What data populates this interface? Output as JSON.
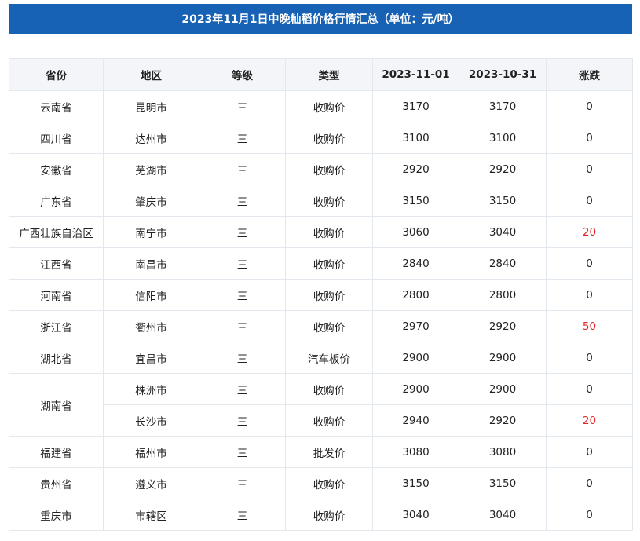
{
  "title": "2023年11月1日中晚籼稻价格行情汇总（单位：元/吨）",
  "headers": [
    "省份",
    "地区",
    "等级",
    "类型",
    "2023-11-01",
    "2023-10-31",
    "涨跌"
  ],
  "rows": [
    {
      "province": "云南省",
      "region": "昆明市",
      "grade": "三",
      "type": "收购价",
      "price_1101": "3170",
      "price_1031": "3170",
      "change": "0"
    },
    {
      "province": "四川省",
      "region": "达州市",
      "grade": "三",
      "type": "收购价",
      "price_1101": "3100",
      "price_1031": "3100",
      "change": "0"
    },
    {
      "province": "安徽省",
      "region": "芜湖市",
      "grade": "三",
      "type": "收购价",
      "price_1101": "2920",
      "price_1031": "2920",
      "change": "0"
    },
    {
      "province": "广东省",
      "region": "肇庆市",
      "grade": "三",
      "type": "收购价",
      "price_1101": "3150",
      "price_1031": "3150",
      "change": "0"
    },
    {
      "province": "广西壮族自治区",
      "region": "南宁市",
      "grade": "三",
      "type": "收购价",
      "price_1101": "3060",
      "price_1031": "3040",
      "change": "20"
    },
    {
      "province": "江西省",
      "region": "南昌市",
      "grade": "三",
      "type": "收购价",
      "price_1101": "2840",
      "price_1031": "2840",
      "change": "0"
    },
    {
      "province": "河南省",
      "region": "信阳市",
      "grade": "三",
      "type": "收购价",
      "price_1101": "2800",
      "price_1031": "2800",
      "change": "0"
    },
    {
      "province": "浙江省",
      "region": "衢州市",
      "grade": "三",
      "type": "收购价",
      "price_1101": "2970",
      "price_1031": "2920",
      "change": "50"
    },
    {
      "province": "湖北省",
      "region": "宜昌市",
      "grade": "三",
      "type": "汽车板价",
      "price_1101": "2900",
      "price_1031": "2900",
      "change": "0"
    },
    {
      "province": "湖南省",
      "region": "株洲市",
      "grade": "三",
      "type": "收购价",
      "price_1101": "2900",
      "price_1031": "2900",
      "change": "0"
    },
    {
      "province": "",
      "region": "长沙市",
      "grade": "三",
      "type": "收购价",
      "price_1101": "2940",
      "price_1031": "2920",
      "change": "20"
    },
    {
      "province": "福建省",
      "region": "福州市",
      "grade": "三",
      "type": "批发价",
      "price_1101": "3080",
      "price_1031": "3080",
      "change": "0"
    },
    {
      "province": "贵州省",
      "region": "遵义市",
      "grade": "三",
      "type": "收购价",
      "price_1101": "3150",
      "price_1031": "3150",
      "change": "0"
    },
    {
      "province": "重庆市",
      "region": "市辖区",
      "grade": "三",
      "type": "收购价",
      "price_1101": "3040",
      "price_1031": "3040",
      "change": "0"
    }
  ],
  "colors": {
    "title_bg": "#1762b4",
    "header_bg": "#f3f5f9",
    "up": "#e32626",
    "border": "#e3e8ee"
  }
}
